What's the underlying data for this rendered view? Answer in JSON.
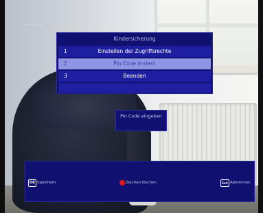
{
  "channel_logo": "— — —",
  "menu": {
    "title": "Kindersicherung",
    "items": [
      {
        "number": "1",
        "label": "Einstellen der Zugriffsrechte",
        "selected": false
      },
      {
        "number": "2",
        "label": "Pin Code ändern",
        "selected": true
      },
      {
        "number": "3",
        "label": "Beenden",
        "selected": false
      }
    ]
  },
  "pin_prompt": "Pin Code eingeben",
  "keybar": {
    "ok": {
      "key": "OK",
      "label": "Speichern"
    },
    "red": {
      "key_icon": "red-dot-icon",
      "label": "Zeichen löschen"
    },
    "exit": {
      "key": "Exit",
      "label": "Abbrechen"
    }
  },
  "colors": {
    "osd_background": "#101070",
    "osd_row": "#1e1ea0",
    "osd_selected_row": "#8f95e3",
    "red_key": "#e01818"
  }
}
